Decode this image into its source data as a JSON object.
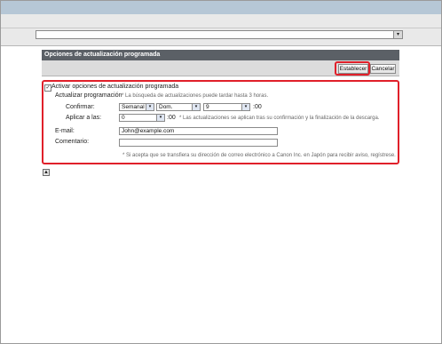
{
  "top_select": {
    "value": ""
  },
  "panel": {
    "title": "Opciones de actualización programada",
    "set_button": "Establecer",
    "cancel_button": "Cancelar"
  },
  "form": {
    "enable_label": "Activar opciones de actualización programada",
    "enable_checked": true,
    "update_schedule_label": "Actualizar programación",
    "update_note": "* La búsqueda de actualizaciones puede tardar hasta 3 horas.",
    "confirm_label": "Confirmar:",
    "frequency": "Semanal",
    "day": "Dom.",
    "hour": "9",
    "minutes_suffix": ":00",
    "apply_label": "Aplicar a las:",
    "apply_hour": "0",
    "apply_note": "* Las actualizaciones se aplican tras su confirmación y la finalización de la descarga.",
    "email_label": "E-mail:",
    "email_value": "John@example.com",
    "comment_label": "Comentario:",
    "comment_value": "",
    "footnote": "* Si acepta que se transfiera su dirección de correo electrónico a Canon Inc. en Japón para recibir aviso, regístrese."
  },
  "icons": {
    "dropdown": "▾",
    "check": "✓",
    "collapse": "▲"
  },
  "colors": {
    "highlight": "#e0202a",
    "panel_header": "#5b6066",
    "top_bar": "#b6c7d6"
  }
}
